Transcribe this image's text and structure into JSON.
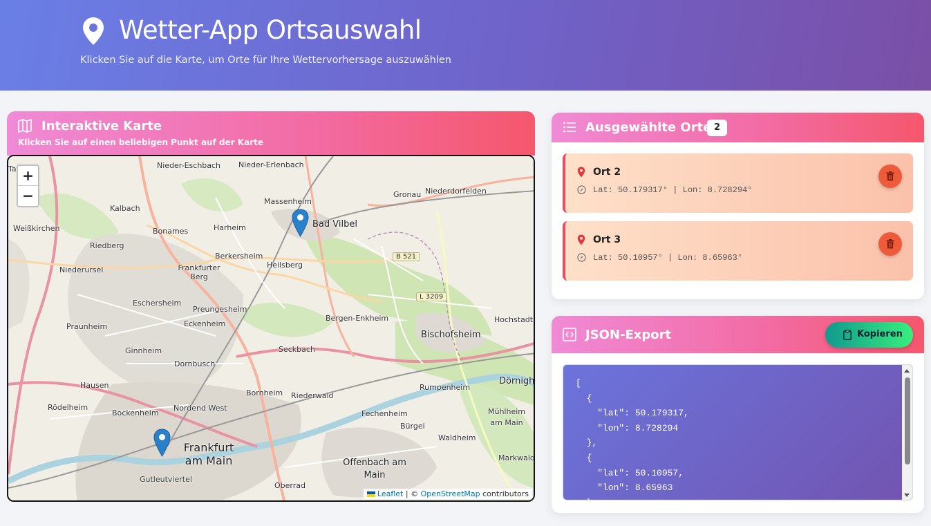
{
  "header": {
    "title": "Wetter-App Ortsauswahl",
    "subtitle": "Klicken Sie auf die Karte, um Orte für Ihre Wettervorhersage auszuwählen"
  },
  "map_panel": {
    "title": "Interaktive Karte",
    "subtitle": "Klicken Sie auf einen beliebigen Punkt auf der Karte",
    "zoom_in": "+",
    "zoom_out": "−",
    "attribution": {
      "leaflet": "Leaflet",
      "separator": " | © ",
      "osm": "OpenStreetMap",
      "suffix": " contributors"
    },
    "labels": {
      "taunus": "Ta      s)",
      "nieder_eschbach": "Nieder-Eschbach",
      "nieder_erlenbach": "Nieder-Erlenbach",
      "gronau": "Gronau",
      "niederdorfelden": "Niederdorfelden",
      "kalbach": "Kalbach",
      "massenheim": "Massenheim",
      "weisskirchen": "Weißkirchen",
      "bonames": "Bonames",
      "harheim": "Harheim",
      "bad_vilbel": "Bad Vilbel",
      "riedberg": "Riedberg",
      "niederursel": "Niederursel",
      "berkersheim": "Berkersheim",
      "heilsberg": "Heilsberg",
      "b521": "B 521",
      "frankfurter_berg": "Frankfurter Berg",
      "eschersheim": "Eschersheim",
      "preungesheim": "Preungesheim",
      "l3209": "L 3209",
      "hochstadt": "Hochstadt",
      "praunheim": "Praunheim",
      "eckenheim": "Eckenheim",
      "bergen_enkheim": "Bergen-Enkheim",
      "bischofsheim": "Bischofsheim",
      "ginnheim": "Ginnheim",
      "seckbach": "Seckbach",
      "dornbusch": "Dornbusch",
      "doernigheim": "Dörnigh",
      "hausen": "Hausen",
      "rumpenheim": "Rumpenheim",
      "roedelheim": "Rödelheim",
      "bornheim": "Bornheim",
      "riederwald": "Riederwald",
      "nordend_west": "Nordend West",
      "fechenheim": "Fechenheim",
      "muehlheim": "Mühlheim am Main",
      "bockenheim": "Bockenheim",
      "buergel": "Bürgel",
      "frankfurt": "Frankfurt am Main",
      "waldheim": "Waldheim",
      "markwald": "Markwald",
      "offenbach": "Offenbach am Main",
      "gutleutviertel": "Gutleutviertel",
      "oberrad": "Oberrad"
    }
  },
  "places_panel": {
    "title": "Ausgewählte Orte",
    "count": "2",
    "places": [
      {
        "name": "Ort 2",
        "coords": "Lat: 50.179317° | Lon: 8.728294°"
      },
      {
        "name": "Ort 3",
        "coords": "Lat: 50.10957° | Lon: 8.65963°"
      }
    ]
  },
  "json_panel": {
    "title": "JSON-Export",
    "copy_label": "Kopieren",
    "content": "[\n  {\n    \"lat\": 50.179317,\n    \"lon\": 8.728294\n  },\n  {\n    \"lat\": 50.10957,\n    \"lon\": 8.65963\n  }\n]"
  },
  "colors": {
    "header_gradient_start": "#6a7fe6",
    "header_gradient_end": "#7a4fa6",
    "card_head_start": "#f08ad6",
    "card_head_end": "#f5576c",
    "copy_gradient_start": "#11998e",
    "copy_gradient_end": "#38ef7d",
    "marker": "#2a81cb",
    "delete": "#ee5b3b"
  }
}
